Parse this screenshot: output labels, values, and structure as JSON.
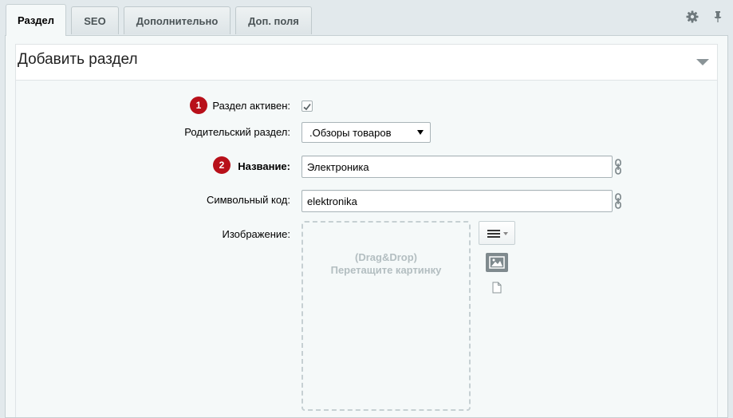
{
  "tabs": [
    {
      "label": "Раздел",
      "active": true
    },
    {
      "label": "SEO",
      "active": false
    },
    {
      "label": "Дополнительно",
      "active": false
    },
    {
      "label": "Доп. поля",
      "active": false
    }
  ],
  "header": {
    "title": "Добавить раздел"
  },
  "form": {
    "active": {
      "badge": "1",
      "label": "Раздел активен:",
      "checked": true
    },
    "parent": {
      "label": "Родительский раздел:",
      "value": ".Обзоры товаров"
    },
    "name": {
      "badge": "2",
      "label": "Название:",
      "value": "Электроника"
    },
    "code": {
      "label": "Символьный код:",
      "value": "elektronika"
    },
    "image": {
      "label": "Изображение:",
      "dropzone_line1": "(Drag&Drop)",
      "dropzone_line2": "Перетащите картинку"
    }
  },
  "icons": {
    "settings": "gear-icon",
    "pin": "pin-icon",
    "collapse": "triangle-down-icon",
    "link": "chain-link-icon",
    "menu": "hamburger-menu-icon",
    "image": "image-icon",
    "file": "file-icon"
  },
  "colors": {
    "badge": "#b8101a",
    "background": "#e2e9ec",
    "panel": "#f5f9f9"
  }
}
